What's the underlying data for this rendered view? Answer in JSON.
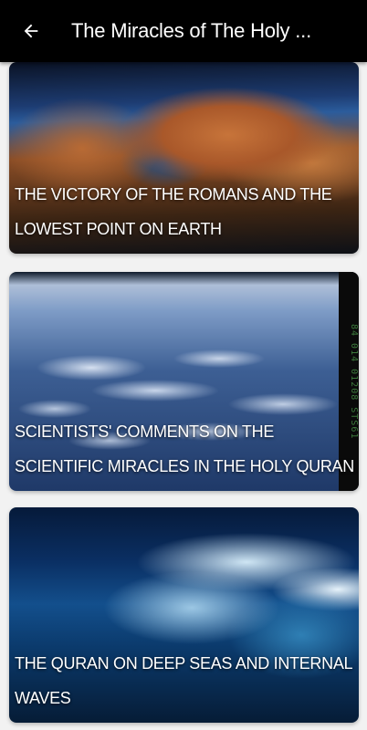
{
  "appbar": {
    "title": "The Miracles of The Holy ...",
    "back_icon": "arrow-left-icon"
  },
  "cards": [
    {
      "caption": "THE VICTORY OF THE ROMANS AND THE LOWEST POINT ON EARTH",
      "image": "earth-from-orbit-image"
    },
    {
      "caption": "SCIENTISTS' COMMENTS ON THE SCIENTIFIC MIRACLES IN THE HOLY QURAN",
      "image": "clouds-from-space-image",
      "strip_text": "84 014   01208 STS61"
    },
    {
      "caption": "THE QURAN ON DEEP SEAS AND INTERNAL WAVES",
      "image": "ocean-wave-image"
    }
  ],
  "colors": {
    "appbar": "#000000",
    "background": "#f2f2f2",
    "caption_text": "#ffffff"
  }
}
